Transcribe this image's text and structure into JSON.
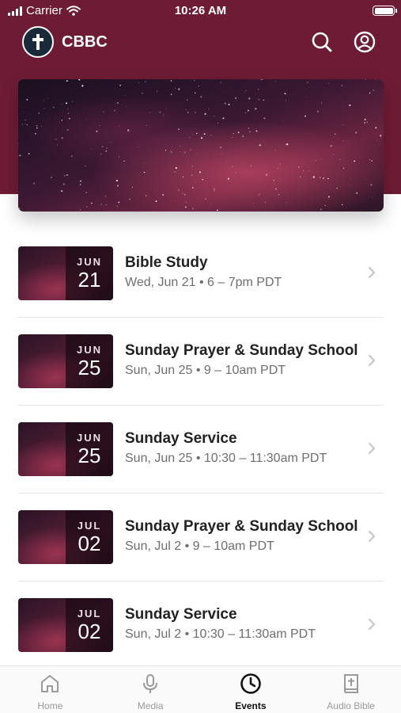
{
  "status_bar": {
    "carrier": "Carrier",
    "time": "10:26 AM"
  },
  "app": {
    "title": "CBBC"
  },
  "colors": {
    "brand": "#6e1c36",
    "tab_active": "#111111",
    "tab_inactive": "#9a9a9a"
  },
  "icons": {
    "logo": "cross-icon",
    "search": "search-icon",
    "profile": "user-circle-icon",
    "row": "chevron-right-icon"
  },
  "events": [
    {
      "month": "JUN",
      "day": "21",
      "title": "Bible Study",
      "subtitle": "Wed, Jun 21 • 6 – 7pm PDT"
    },
    {
      "month": "JUN",
      "day": "25",
      "title": "Sunday Prayer & Sunday School",
      "subtitle": "Sun, Jun 25 • 9 – 10am PDT"
    },
    {
      "month": "JUN",
      "day": "25",
      "title": "Sunday Service",
      "subtitle": "Sun, Jun 25 • 10:30 – 11:30am PDT"
    },
    {
      "month": "JUL",
      "day": "02",
      "title": "Sunday Prayer & Sunday School",
      "subtitle": "Sun, Jul 2 • 9 – 10am PDT"
    },
    {
      "month": "JUL",
      "day": "02",
      "title": "Sunday Service",
      "subtitle": "Sun, Jul 2 • 10:30 – 11:30am PDT"
    }
  ],
  "tabs": [
    {
      "label": "Home",
      "icon": "home-icon",
      "active": false
    },
    {
      "label": "Media",
      "icon": "microphone-icon",
      "active": false
    },
    {
      "label": "Events",
      "icon": "clock-icon",
      "active": true
    },
    {
      "label": "Audio Bible",
      "icon": "bible-icon",
      "active": false
    }
  ]
}
